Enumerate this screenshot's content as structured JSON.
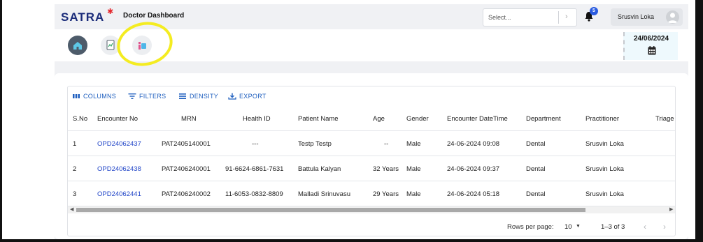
{
  "app": {
    "logo_text": "SATRA",
    "title": "Doctor Dashboard"
  },
  "header": {
    "select_placeholder": "Select...",
    "notification_count": "5",
    "user_name": "Srusvin Loka"
  },
  "nav_icons": [
    "home-icon",
    "document-icon",
    "info-icon"
  ],
  "date_panel": {
    "date": "24/06/2024"
  },
  "grid": {
    "toolbar": {
      "columns": "COLUMNS",
      "filters": "FILTERS",
      "density": "DENSITY",
      "export": "EXPORT"
    },
    "columns": [
      "S.No",
      "Encounter No",
      "MRN",
      "Health ID",
      "Patient Name",
      "Age",
      "Gender",
      "Encounter DateTime",
      "Department",
      "Practitioner",
      "Triage"
    ],
    "rows": [
      [
        "1",
        "OPD24062437",
        "PAT2405140001",
        "---",
        "Testp Testp",
        "--",
        "Male",
        "24-06-2024 09:08",
        "Dental",
        "Srusvin Loka"
      ],
      [
        "2",
        "OPD24062438",
        "PAT2406240001",
        "91-6624-6861-7631",
        "Battula Kalyan",
        "32 Years",
        "Male",
        "24-06-2024 09:37",
        "Dental",
        "Srusvin Loka"
      ],
      [
        "3",
        "OPD24062441",
        "PAT2406240002",
        "11-6053-0832-8809",
        "Malladi Srinuvasu",
        "29 Years",
        "Male",
        "24-06-2024 05:18",
        "Dental",
        "Srusvin Loka"
      ]
    ],
    "footer": {
      "rows_per_page_label": "Rows per page:",
      "rows_per_page_value": "10",
      "range": "1–3 of 3"
    }
  },
  "colors": {
    "brand_navy": "#1b2c7a",
    "link_blue": "#2246c8",
    "toolbar_blue": "#1f5fbf",
    "annotation_yellow": "#f4ec21"
  }
}
